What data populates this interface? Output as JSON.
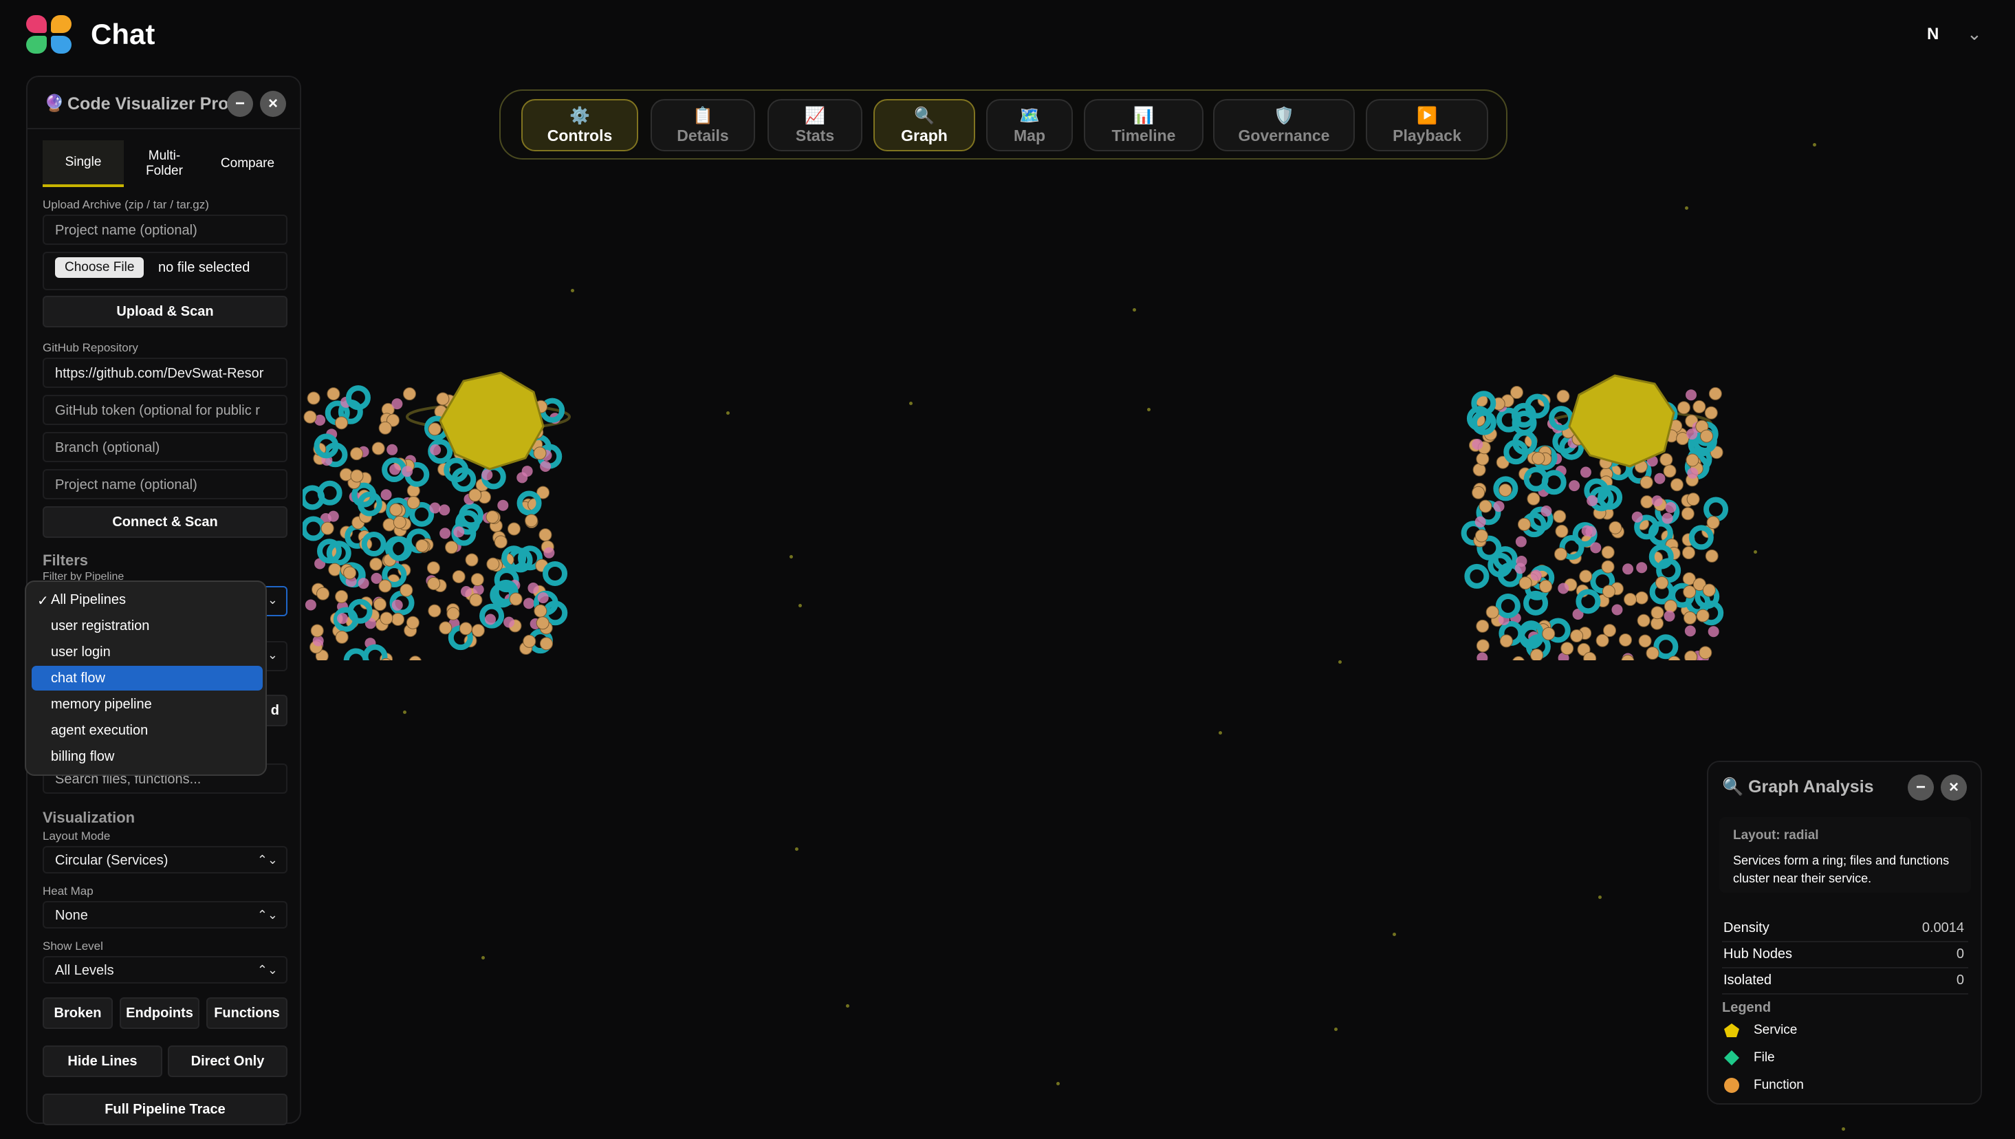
{
  "app": {
    "title": "Chat",
    "user_initial": "N",
    "user_menu_icon": "chevron-down-icon"
  },
  "panel": {
    "title": "Code Visualizer Pro",
    "icon": "crystal-ball-icon",
    "tabs": [
      {
        "label": "Single",
        "active": true
      },
      {
        "label": "Multi-\nFolder",
        "active": false
      },
      {
        "label": "Compare",
        "active": false
      }
    ],
    "upload": {
      "label": "Upload Archive (zip / tar / tar.gz)",
      "project_placeholder": "Project name (optional)",
      "choose_file": "Choose File",
      "file_status": "no file selected",
      "button": "Upload & Scan"
    },
    "github": {
      "label": "GitHub Repository",
      "repo_value": "https://github.com/DevSwat-Resor",
      "token_placeholder": "GitHub token (optional for public r",
      "branch_placeholder": "Branch (optional)",
      "project_placeholder": "Project name (optional)",
      "button": "Connect & Scan"
    },
    "filters": {
      "title": "Filters",
      "pipeline_label": "Filter by Pipeline",
      "search_placeholder": "Search files, functions...",
      "hidden_button_tail": "d"
    },
    "visualization": {
      "title": "Visualization",
      "layout_label": "Layout Mode",
      "layout_value": "Circular (Services)",
      "heatmap_label": "Heat Map",
      "heatmap_value": "None",
      "level_label": "Show Level",
      "level_value": "All Levels",
      "buttons_row1": [
        "Broken",
        "Endpoints",
        "Functions"
      ],
      "buttons_row2": [
        "Hide Lines",
        "Direct Only"
      ],
      "full_trace": "Full Pipeline Trace"
    }
  },
  "pipeline_dropdown": {
    "options": [
      "All Pipelines",
      "user registration",
      "user login",
      "chat flow",
      "memory pipeline",
      "agent execution",
      "billing flow"
    ],
    "checked": "All Pipelines",
    "highlighted": "chat flow"
  },
  "top_tabs": [
    {
      "label": "Controls",
      "icon": "⚙️",
      "active": true
    },
    {
      "label": "Details",
      "icon": "📋",
      "active": false
    },
    {
      "label": "Stats",
      "icon": "📈",
      "active": false
    },
    {
      "label": "Graph",
      "icon": "🔍",
      "active": true
    },
    {
      "label": "Map",
      "icon": "🗺️",
      "active": false
    },
    {
      "label": "Timeline",
      "icon": "📊",
      "active": false
    },
    {
      "label": "Governance",
      "icon": "🛡️",
      "active": false
    },
    {
      "label": "Playback",
      "icon": "▶️",
      "active": false
    }
  ],
  "analysis": {
    "title": "Graph Analysis",
    "icon": "magnifier-icon",
    "layout_label": "Layout: radial",
    "layout_desc": "Services form a ring; files and functions cluster near their service.",
    "metrics": [
      {
        "name": "Density",
        "value": "0.0014"
      },
      {
        "name": "Hub Nodes",
        "value": "0"
      },
      {
        "name": "Isolated",
        "value": "0"
      }
    ],
    "legend_title": "Legend",
    "legend": [
      {
        "label": "Service",
        "color": "#e8c800",
        "shape": "pentagon"
      },
      {
        "label": "File",
        "color": "#1ec98a",
        "shape": "diamond"
      },
      {
        "label": "Function",
        "color": "#e89a3a",
        "shape": "circle"
      }
    ]
  },
  "colors": {
    "accent": "#c8b400",
    "service": "#d4c018",
    "file": "#1aa6b0",
    "function": "#d4a060",
    "pink": "#d47ab0",
    "selection": "#1f66c8"
  }
}
